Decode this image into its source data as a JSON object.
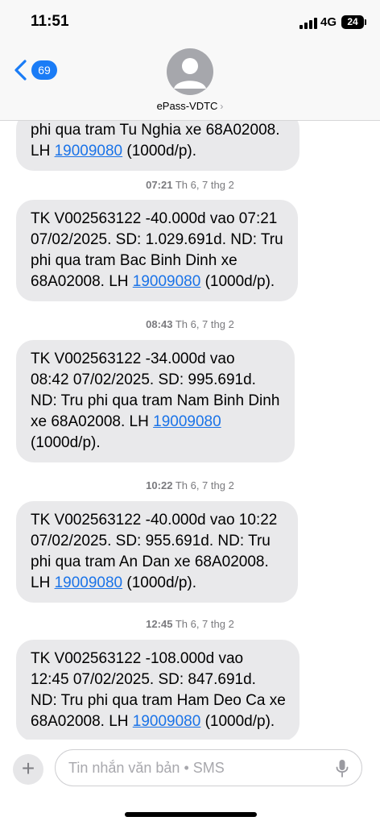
{
  "status_bar": {
    "time": "11:51",
    "network": "4G",
    "battery": "24"
  },
  "header": {
    "back_count": "69",
    "contact_name": "ePass-VDTC"
  },
  "messages": [
    {
      "kind": "bubble",
      "text": "phi qua tram Tu Nghia xe 68A02008.\nLH ",
      "phone": "19009080",
      "tail": " (1000d/p)."
    },
    {
      "kind": "timestamp",
      "time": "07:21",
      "date": "Th 6, 7 thg 2"
    },
    {
      "kind": "bubble",
      "text": "TK V002563122 -40.000d vao 07:21\n07/02/2025. SD: 1.029.691d. ND: Tru\nphi qua tram Bac Binh Dinh xe\n68A02008. LH ",
      "phone": "19009080",
      "tail": " (1000d/p)."
    },
    {
      "kind": "timestamp",
      "time": "08:43",
      "date": "Th 6, 7 thg 2"
    },
    {
      "kind": "bubble",
      "text": "TK V002563122 -34.000d vao\n08:42 07/02/2025. SD: 995.691d.\nND: Tru phi qua tram Nam Binh Dinh\nxe 68A02008. LH ",
      "phone": "19009080",
      "tail": "\n(1000d/p)."
    },
    {
      "kind": "timestamp",
      "time": "10:22",
      "date": "Th 6, 7 thg 2"
    },
    {
      "kind": "bubble",
      "text": "TK V002563122 -40.000d vao 10:22\n07/02/2025. SD: 955.691d. ND: Tru\nphi qua tram An Dan xe 68A02008.\nLH ",
      "phone": "19009080",
      "tail": " (1000d/p)."
    },
    {
      "kind": "timestamp",
      "time": "12:45",
      "date": "Th 6, 7 thg 2"
    },
    {
      "kind": "bubble",
      "text": "TK V002563122 -108.000d vao\n12:45 07/02/2025. SD: 847.691d.\nND: Tru phi qua tram Ham Deo Ca xe\n68A02008. LH ",
      "phone": "19009080",
      "tail": " (1000d/p)."
    }
  ],
  "input": {
    "placeholder": "Tin nhắn văn bản • SMS",
    "value": ""
  },
  "colors": {
    "bubble": "#e9e9eb",
    "link": "#1a73e8",
    "accent": "#1a7cf6"
  }
}
